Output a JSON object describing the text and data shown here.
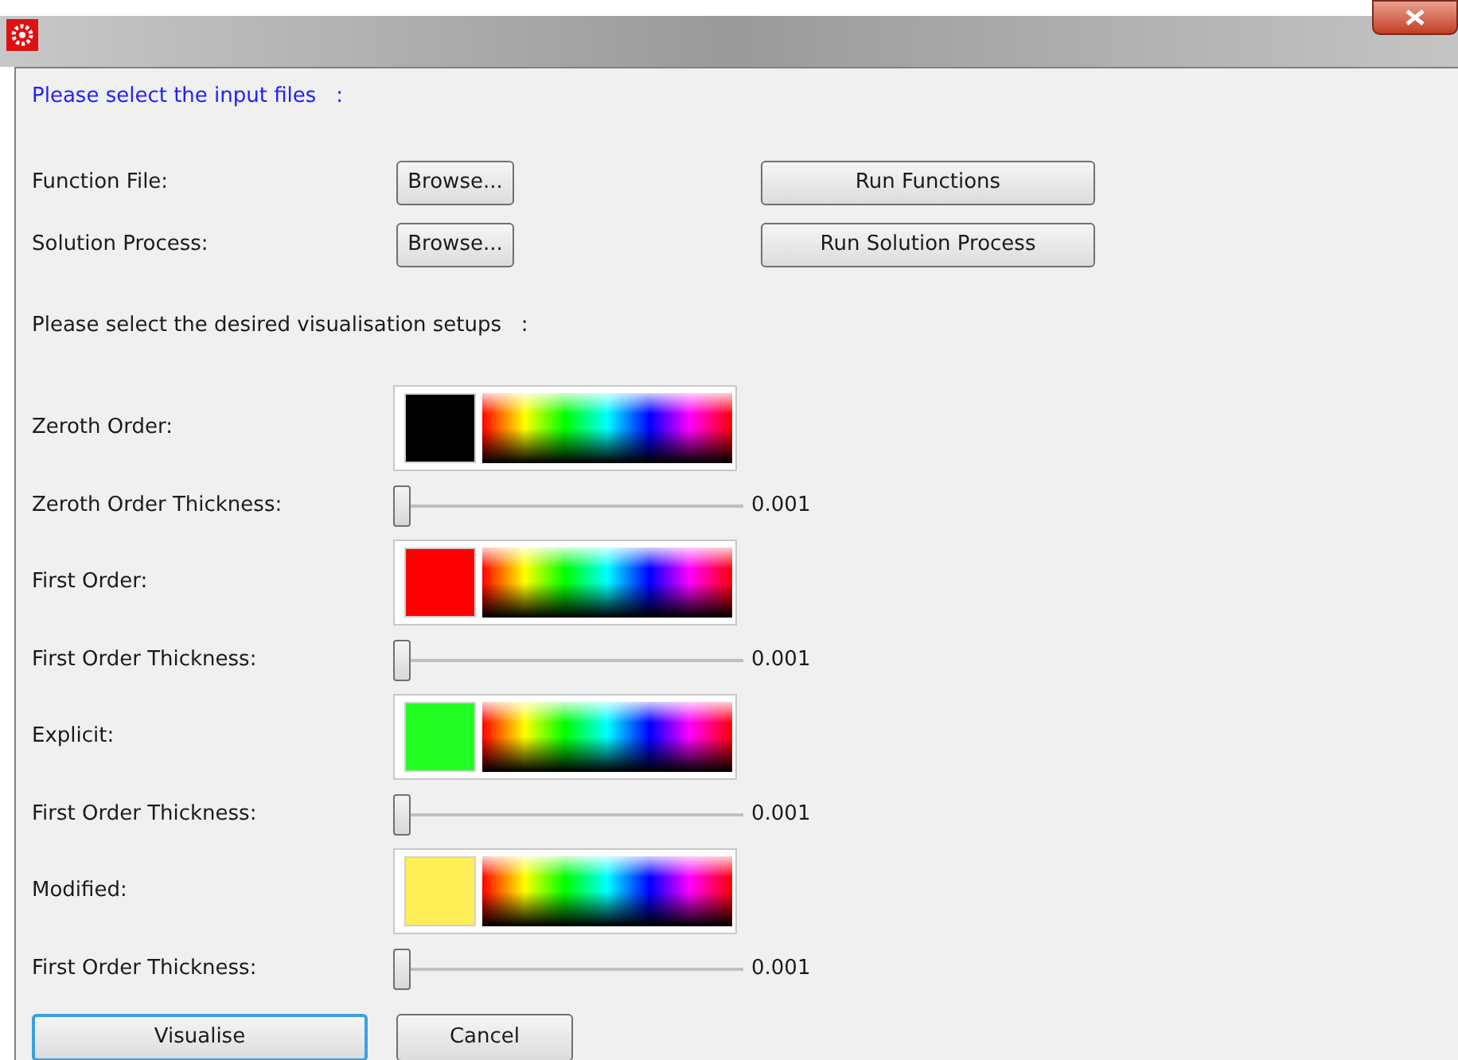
{
  "input_heading": "Please select the input files   :",
  "file_rows": [
    {
      "label": "Function File:",
      "browse": "Browse...",
      "action": "Run Functions"
    },
    {
      "label": "Solution Process:",
      "browse": "Browse...",
      "action": "Run Solution Process"
    }
  ],
  "visual_heading": "Please select the desired visualisation setups   :",
  "setups": [
    {
      "kind": "color",
      "label": "Zeroth Order:",
      "color": "#000000"
    },
    {
      "kind": "slider",
      "label": "Zeroth Order Thickness:",
      "level": 0,
      "reading": "0.001"
    },
    {
      "kind": "color",
      "label": "First Order:",
      "color": "#ff0000"
    },
    {
      "kind": "slider",
      "label": "First Order Thickness:",
      "level": 0,
      "reading": "0.001"
    },
    {
      "kind": "color",
      "label": "Explicit:",
      "color": "#22ff22"
    },
    {
      "kind": "slider",
      "label": "First Order Thickness:",
      "level": 0,
      "reading": "0.001"
    },
    {
      "kind": "color",
      "label": "Modified:",
      "color": "#ffee55"
    },
    {
      "kind": "slider",
      "label": "First Order Thickness:",
      "level": 0,
      "reading": "0.001"
    }
  ],
  "buttons": [
    {
      "label": "Visualise",
      "focused": true
    },
    {
      "label": "Cancel",
      "focused": false
    }
  ]
}
